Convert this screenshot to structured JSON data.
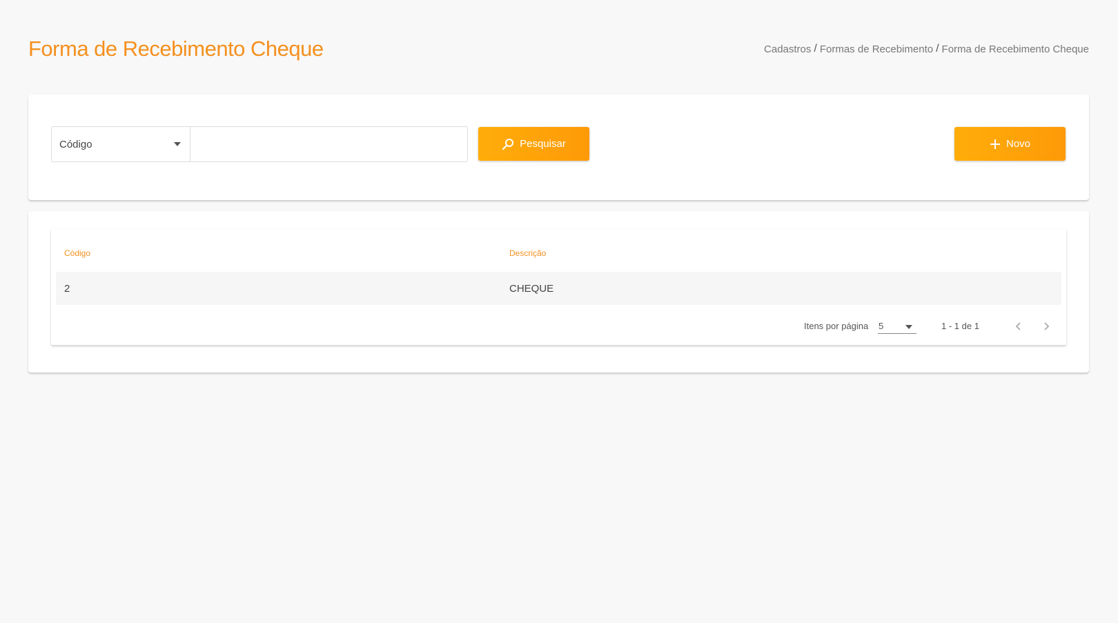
{
  "header": {
    "title": "Forma de Recebimento Cheque",
    "breadcrumb": [
      "Cadastros",
      "Formas de Recebimento",
      "Forma de Recebimento Cheque"
    ],
    "separator": "/"
  },
  "search": {
    "filter_selected": "Código",
    "input_value": "",
    "search_button_label": "Pesquisar",
    "new_button_label": "Novo"
  },
  "table": {
    "columns": [
      "Código",
      "Descrição"
    ],
    "rows": [
      {
        "codigo": "2",
        "descricao": "CHEQUE"
      }
    ]
  },
  "paginator": {
    "items_label": "Itens por página",
    "page_size": "5",
    "range_label": "1 - 1 de 1"
  },
  "colors": {
    "accent": "#f5901e",
    "button_gradient_start": "#ffad0a",
    "button_gradient_end": "#fe9a08"
  },
  "icons": [
    "caret-down-icon",
    "search-icon",
    "plus-icon",
    "chevron-left-icon",
    "chevron-right-icon"
  ]
}
